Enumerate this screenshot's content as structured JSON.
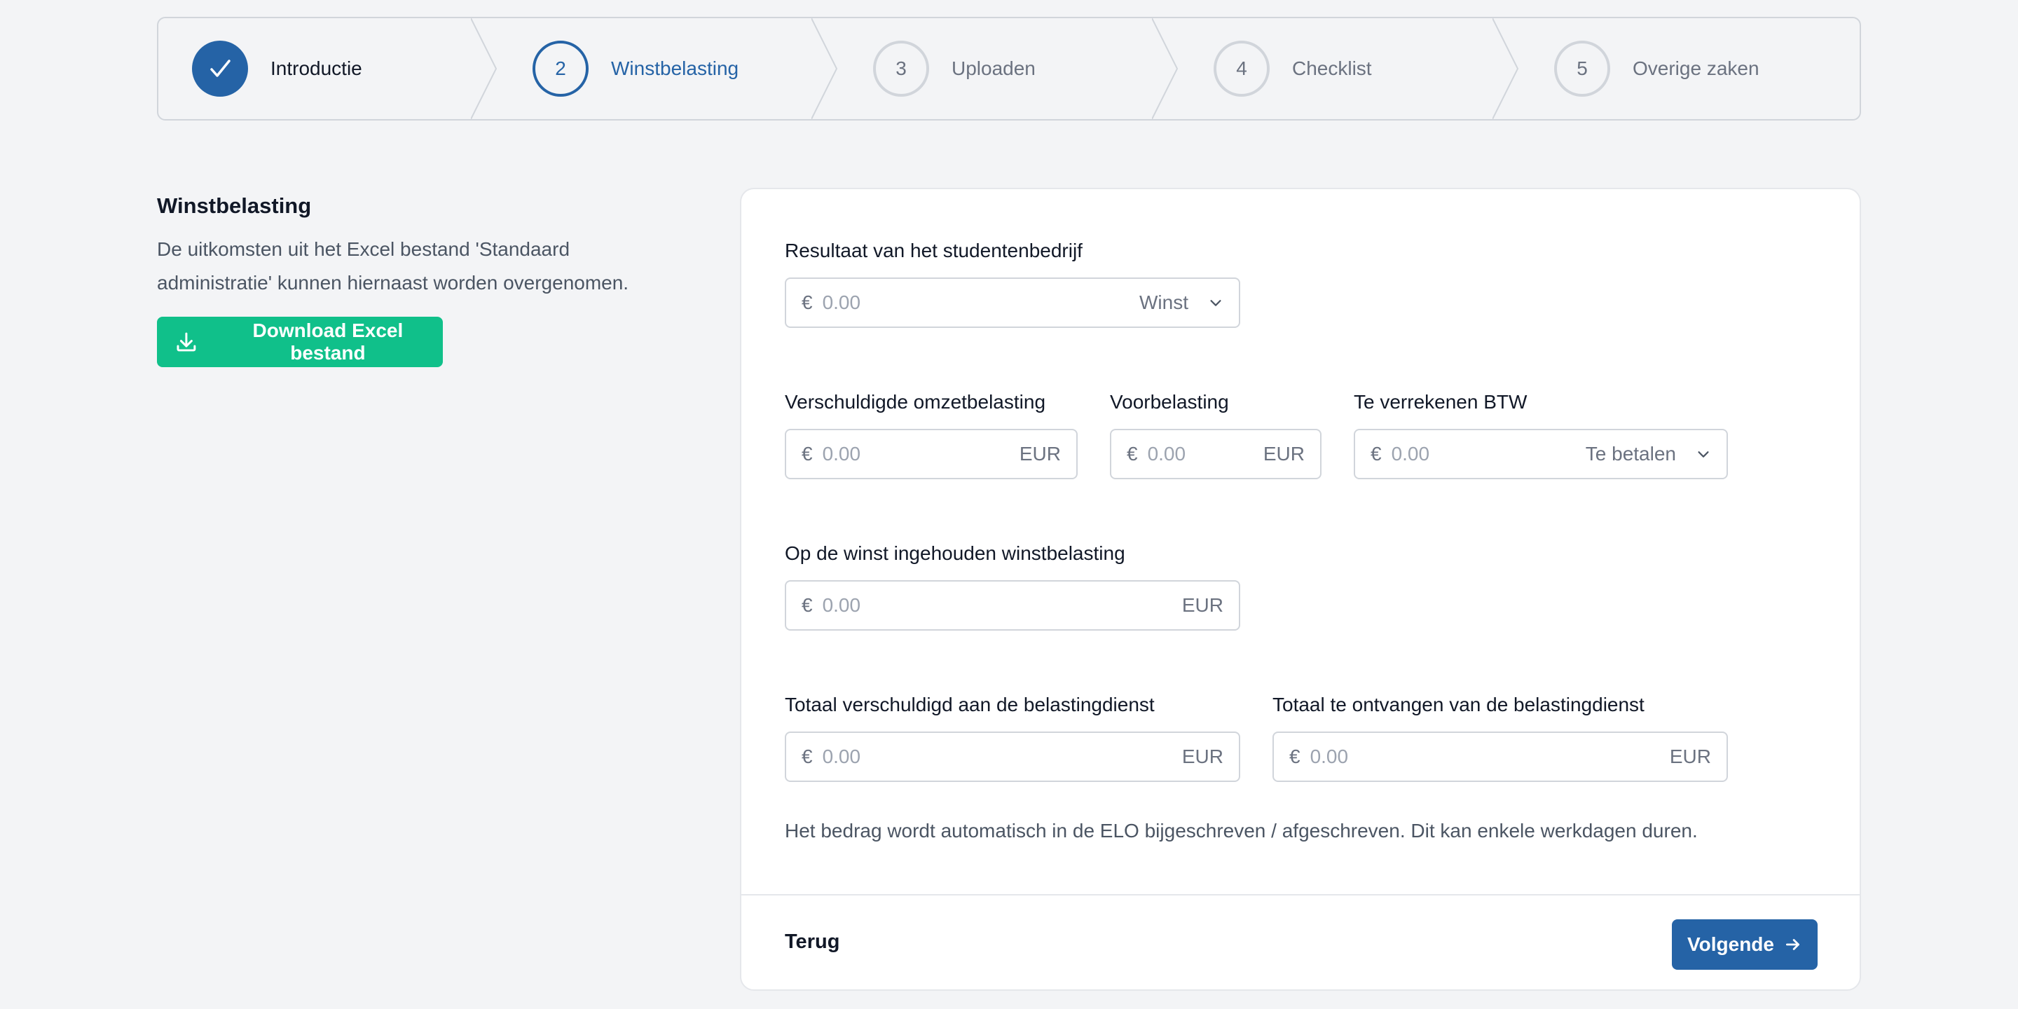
{
  "stepper": {
    "steps": [
      {
        "number": "1",
        "label": "Introductie",
        "status": "done"
      },
      {
        "number": "2",
        "label": "Winstbelasting",
        "status": "current"
      },
      {
        "number": "3",
        "label": "Uploaden",
        "status": "upcoming"
      },
      {
        "number": "4",
        "label": "Checklist",
        "status": "upcoming"
      },
      {
        "number": "5",
        "label": "Overige zaken",
        "status": "upcoming"
      }
    ]
  },
  "intro": {
    "title": "Winstbelasting",
    "description": "De uitkomsten uit het Excel bestand 'Standaard administratie' kunnen hiernaast worden overgenomen.",
    "download_label": "Download Excel bestand"
  },
  "form": {
    "resultaat": {
      "label": "Resultaat van het studentenbedrijf",
      "currency": "€",
      "placeholder": "0.00",
      "select_value": "Winst"
    },
    "omzetbelasting": {
      "label": "Verschuldigde omzetbelasting",
      "currency": "€",
      "placeholder": "0.00",
      "unit": "EUR"
    },
    "voorbelasting": {
      "label": "Voorbelasting",
      "currency": "€",
      "placeholder": "0.00",
      "unit": "EUR"
    },
    "btw": {
      "label": "Te verrekenen BTW",
      "currency": "€",
      "placeholder": "0.00",
      "select_value": "Te betalen"
    },
    "ingehouden": {
      "label": "Op de winst ingehouden winstbelasting",
      "currency": "€",
      "placeholder": "0.00",
      "unit": "EUR"
    },
    "verschuldigd": {
      "label": "Totaal verschuldigd aan de belastingdienst",
      "currency": "€",
      "placeholder": "0.00",
      "unit": "EUR"
    },
    "ontvangen": {
      "label": "Totaal te ontvangen van de belastingdienst",
      "currency": "€",
      "placeholder": "0.00",
      "unit": "EUR"
    },
    "note": "Het bedrag wordt automatisch in de ELO bijgeschreven / afgeschreven. Dit kan enkele werkdagen duren."
  },
  "footer": {
    "back_label": "Terug",
    "next_label": "Volgende"
  },
  "colors": {
    "primary": "#2563a6",
    "success": "#10c08a",
    "border": "#d1d5db",
    "background": "#f3f4f6"
  }
}
